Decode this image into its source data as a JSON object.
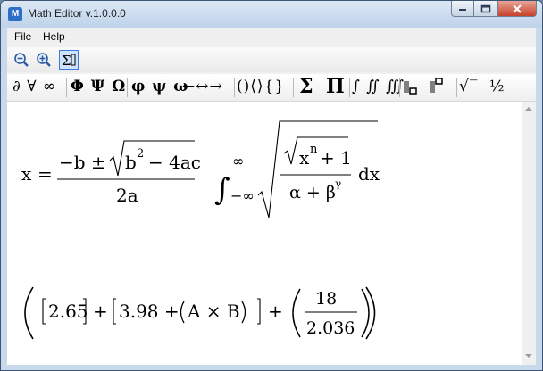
{
  "window": {
    "title": "Math Editor v.1.0.0.0",
    "icon_letter": "M",
    "controls": [
      "minimize",
      "maximize",
      "close"
    ]
  },
  "menu": [
    {
      "label": "File"
    },
    {
      "label": "Help"
    }
  ],
  "toolbar_top": [
    {
      "name": "zoom-out-icon"
    },
    {
      "name": "zoom-in-icon"
    },
    {
      "name": "sigma-toggle-icon",
      "active": true
    }
  ],
  "symbol_groups": [
    {
      "name": "misc",
      "symbols": "∂ ∀ ∞"
    },
    {
      "name": "upper-greek",
      "symbols": "Φ Ψ Ω"
    },
    {
      "name": "lower-greek",
      "symbols": "φ ψ ω"
    },
    {
      "name": "arrows",
      "symbols": "←↔→"
    },
    {
      "name": "brackets",
      "symbols": "()⟨⟩{}"
    },
    {
      "name": "sum",
      "symbols": "Σ"
    },
    {
      "name": "product",
      "symbols": "Π"
    },
    {
      "name": "integrals",
      "symbols": "∫ ∬ ∭"
    },
    {
      "name": "scripts",
      "symbols": ""
    },
    {
      "name": "root",
      "symbols": "√‾"
    },
    {
      "name": "fraction",
      "symbols": "½"
    }
  ],
  "document": {
    "eq1": {
      "lhs": "x",
      "eq": "=",
      "num_minus_b": "−b ±",
      "b": "b",
      "exp2": "2",
      "minus4ac": "− 4ac",
      "den": "2a"
    },
    "eq2": {
      "int_sup": "∞",
      "int_sub": "−∞",
      "xn_x": "x",
      "xn_n": "n",
      "plus1": "+ 1",
      "den_alpha": "α + β",
      "den_gamma": "γ",
      "dx": "dx"
    },
    "eq3": {
      "v1": "2.65",
      "plus": "+",
      "v2": "3.98 +",
      "paren_content": "A × B",
      "num": "18",
      "den": "2.036"
    }
  }
}
